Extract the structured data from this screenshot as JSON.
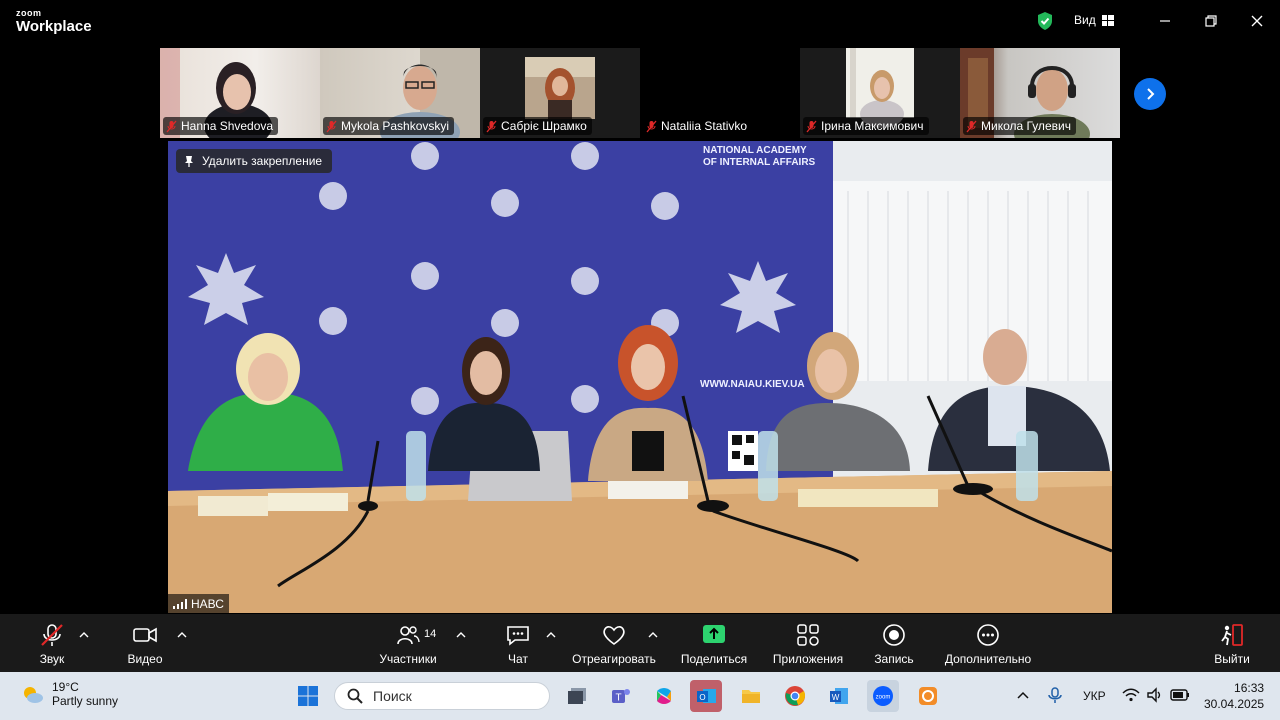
{
  "app": {
    "logo_small": "zoom",
    "logo_big": "Workplace",
    "view_label": "Вид"
  },
  "participants": [
    {
      "name": "Hanna Shvedova"
    },
    {
      "name": "Mykola Pashkovskyi"
    },
    {
      "name": "Сабріє Шрамко"
    },
    {
      "name": "Nataliia Stativko"
    },
    {
      "name": "Ірина Максимович"
    },
    {
      "name": "Микола Гулевич"
    }
  ],
  "main_video": {
    "unpin_label": "Удалить закрепление",
    "speaker_label": "НАВС",
    "backdrop_title": "NATIONAL ACADEMY OF INTERNAL AFFAIRS",
    "backdrop_url": "WWW.NAIAU.KIEV.UA"
  },
  "toolbar": {
    "audio": "Звук",
    "video": "Видео",
    "participants": "Участники",
    "participants_count": "14",
    "chat": "Чат",
    "react": "Отреагировать",
    "share": "Поделиться",
    "apps": "Приложения",
    "record": "Запись",
    "more": "Дополнительно",
    "leave": "Выйти"
  },
  "taskbar": {
    "temperature": "19°C",
    "weather": "Partly sunny",
    "search_placeholder": "Поиск",
    "language": "УКР",
    "time": "16:33",
    "date": "30.04.2025"
  },
  "colors": {
    "accent": "#0e71eb",
    "share_green": "#2dd36f",
    "mic_muted_red": "#e02828",
    "leave_red": "#e02828",
    "backdrop_blue": "#3a3fa0"
  }
}
